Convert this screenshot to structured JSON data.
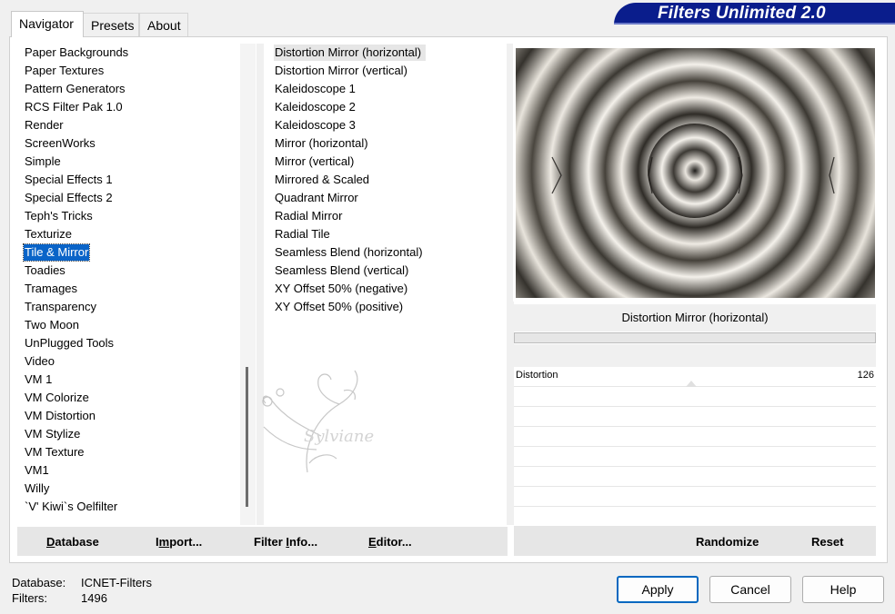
{
  "window": {
    "brand": "Filters Unlimited 2.0",
    "tabs": [
      {
        "label": "Navigator",
        "active": true
      },
      {
        "label": "Presets",
        "active": false
      },
      {
        "label": "About",
        "active": false
      }
    ]
  },
  "categories": {
    "items": [
      "Paper Backgrounds",
      "Paper Textures",
      "Pattern Generators",
      "RCS Filter Pak 1.0",
      "Render",
      "ScreenWorks",
      "Simple",
      "Special Effects 1",
      "Special Effects 2",
      "Teph's Tricks",
      "Texturize",
      "Tile & Mirror",
      "Toadies",
      "Tramages",
      "Transparency",
      "Two Moon",
      "UnPlugged Tools",
      "Video",
      "VM 1",
      "VM Colorize",
      "VM Distortion",
      "VM Stylize",
      "VM Texture",
      "VM1",
      "Willy",
      "`V' Kiwi`s Oelfilter"
    ],
    "selected": "Tile & Mirror"
  },
  "filters": {
    "items": [
      "Distortion Mirror (horizontal)",
      "Distortion Mirror (vertical)",
      "Kaleidoscope 1",
      "Kaleidoscope 2",
      "Kaleidoscope 3",
      "Mirror (horizontal)",
      "Mirror (vertical)",
      "Mirrored & Scaled",
      "Quadrant Mirror",
      "Radial Mirror",
      "Radial Tile",
      "Seamless Blend (horizontal)",
      "Seamless Blend (vertical)",
      "XY Offset 50% (negative)",
      "XY Offset 50% (positive)"
    ],
    "selected": "Distortion Mirror (horizontal)"
  },
  "preview": {
    "filter_name": "Distortion Mirror (horizontal)",
    "watermark": "Sylviane"
  },
  "params": [
    {
      "label": "Distortion",
      "value": "126",
      "level": 0.49
    }
  ],
  "left_buttons": {
    "database": {
      "u": "D",
      "rest": "atabase"
    },
    "import": {
      "pre": "I",
      "u": "m",
      "rest": "port..."
    },
    "filter_info": {
      "pre": "Filter ",
      "u": "I",
      "rest": "nfo..."
    },
    "editor": {
      "u": "E",
      "rest": "ditor..."
    }
  },
  "right_buttons": {
    "randomize": "Randomize",
    "reset": "Reset"
  },
  "status": {
    "database_label": "Database:",
    "database_value": "ICNET-Filters",
    "filters_label": "Filters:",
    "filters_value": "1496"
  },
  "dialog_buttons": {
    "apply": "Apply",
    "cancel": "Cancel",
    "help": "Help"
  },
  "colors": {
    "selection": "#0a64c8",
    "banner": "#0a1d8c",
    "default_button_border": "#0067c0"
  }
}
